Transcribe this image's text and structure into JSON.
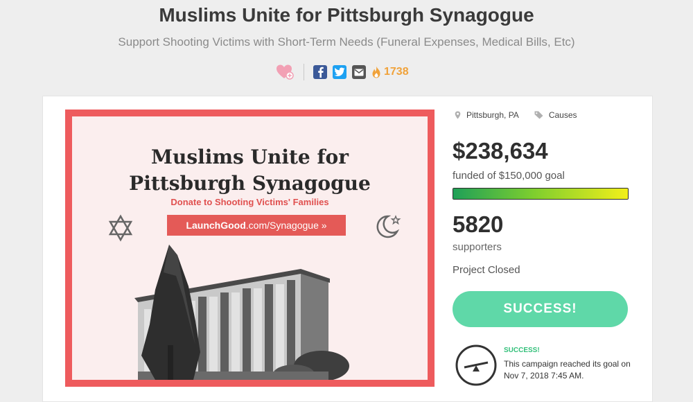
{
  "header": {
    "title": "Muslims Unite for Pittsburgh Synagogue",
    "subtitle": "Support Shooting Victims with Short-Term Needs (Funeral Expenses, Medical Bills, Etc)"
  },
  "share": {
    "count": "1738",
    "icons": [
      "heart-add-icon",
      "facebook-icon",
      "twitter-icon",
      "email-icon",
      "flame-icon"
    ]
  },
  "hero": {
    "title_line1": "Muslims Unite for",
    "title_line2": "Pittsburgh Synagogue",
    "subtitle": "Donate to Shooting Victims' Families",
    "link_brand": "LaunchGood",
    "link_path": ".com/Synagogue »"
  },
  "campaign": {
    "location": "Pittsburgh, PA",
    "category": "Causes",
    "amount": "$238,634",
    "funded_text": "funded of $150,000 goal",
    "progress_fraction": 1.0,
    "supporters_count": "5820",
    "supporters_label": "supporters",
    "status": "Project Closed",
    "success_button": "SUCCESS!",
    "success_title": "SUCCESS!",
    "success_message": "This campaign reached its goal on Nov 7, 2018 7:45 AM."
  },
  "colors": {
    "accent_red": "#ee5b5d",
    "success_green": "#5fd8a8",
    "facebook": "#3b5998",
    "twitter": "#1da1f2",
    "flame": "#f0a23a"
  }
}
